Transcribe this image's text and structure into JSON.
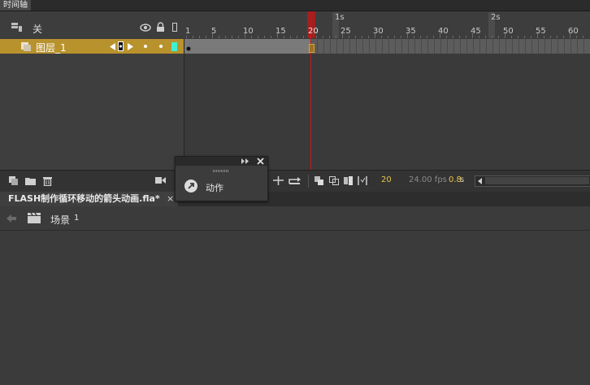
{
  "window": {
    "title": "时间轴"
  },
  "timeline": {
    "header": {
      "layer_toggle_label": "关"
    },
    "layer": {
      "name": "图层_1"
    },
    "ruler": {
      "frame_labels": [
        "1",
        "5",
        "10",
        "15",
        "20",
        "25",
        "30",
        "35",
        "40",
        "45",
        "50",
        "55",
        "60"
      ],
      "second_labels": [
        "1s",
        "2s"
      ]
    },
    "playhead": {
      "frame": 20
    }
  },
  "toolbar": {
    "current_frame": "20",
    "fps": "24.00 fps",
    "time_value": "0.8",
    "time_unit": "s"
  },
  "document": {
    "tab_title": "FLASH制作循环移动的箭头动画.fla*",
    "close_glyph": "×"
  },
  "breadcrumb": {
    "scene_label": "场景",
    "scene_number": "1"
  },
  "float_panel": {
    "item_label": "动作"
  },
  "colors": {
    "layer_highlight": "#b8922c",
    "playhead": "#c41818",
    "accent_yellow": "#e8c34a"
  }
}
